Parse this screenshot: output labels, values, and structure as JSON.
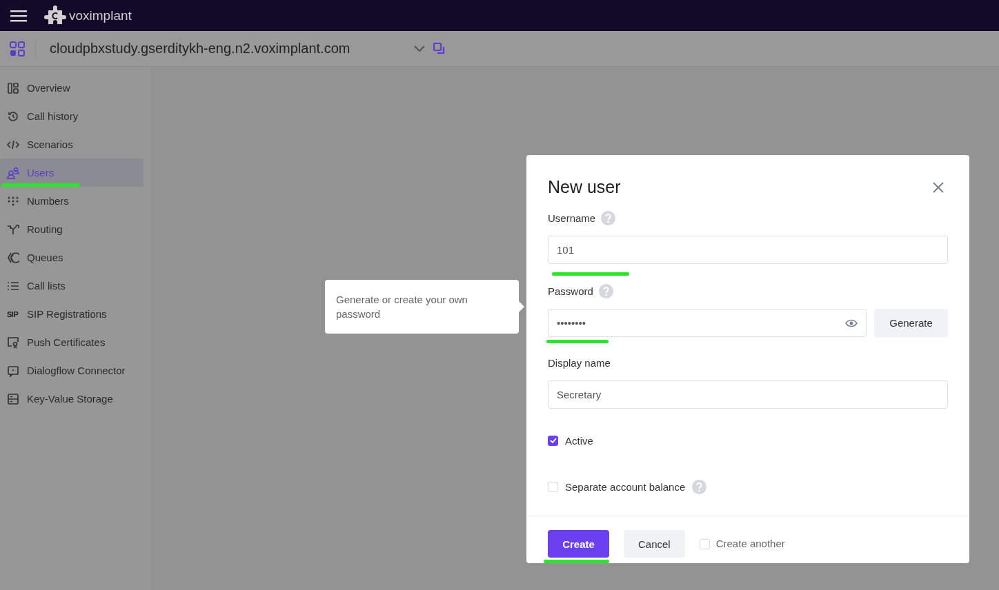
{
  "topbar": {
    "brand": "voximplant"
  },
  "header": {
    "app_name": "cloudpbxstudy.gserditykh-eng.n2.voximplant.com"
  },
  "sidebar": {
    "items": [
      {
        "label": "Overview",
        "selected": false
      },
      {
        "label": "Call history",
        "selected": false
      },
      {
        "label": "Scenarios",
        "selected": false
      },
      {
        "label": "Users",
        "selected": true
      },
      {
        "label": "Numbers",
        "selected": false
      },
      {
        "label": "Routing",
        "selected": false
      },
      {
        "label": "Queues",
        "selected": false
      },
      {
        "label": "Call lists",
        "selected": false
      },
      {
        "label": "SIP Registrations",
        "selected": false,
        "icon_text": "SIP"
      },
      {
        "label": "Push Certificates",
        "selected": false
      },
      {
        "label": "Dialogflow Connector",
        "selected": false
      },
      {
        "label": "Key-Value Storage",
        "selected": false
      }
    ]
  },
  "tooltip": {
    "text": "Generate or create your own password"
  },
  "dialog": {
    "title": "New user",
    "fields": [
      {
        "kind": "text",
        "label": "Username",
        "help": true,
        "value": "101",
        "underline": true
      },
      {
        "kind": "password",
        "label": "Password",
        "help": true,
        "value": "••••••••",
        "button": "Generate",
        "underline": true
      },
      {
        "kind": "text",
        "label": "Display name",
        "help": false,
        "value": "Secretary",
        "underline": false
      }
    ],
    "checkboxes": [
      {
        "label": "Active",
        "checked": true,
        "help": false
      },
      {
        "label": "Separate account balance",
        "checked": false,
        "help": true
      }
    ],
    "buttons": [
      {
        "label": "Create",
        "kind": "primary"
      },
      {
        "label": "Cancel",
        "kind": "secondary"
      }
    ],
    "create_another": {
      "label": "Create another",
      "checked": false
    }
  }
}
